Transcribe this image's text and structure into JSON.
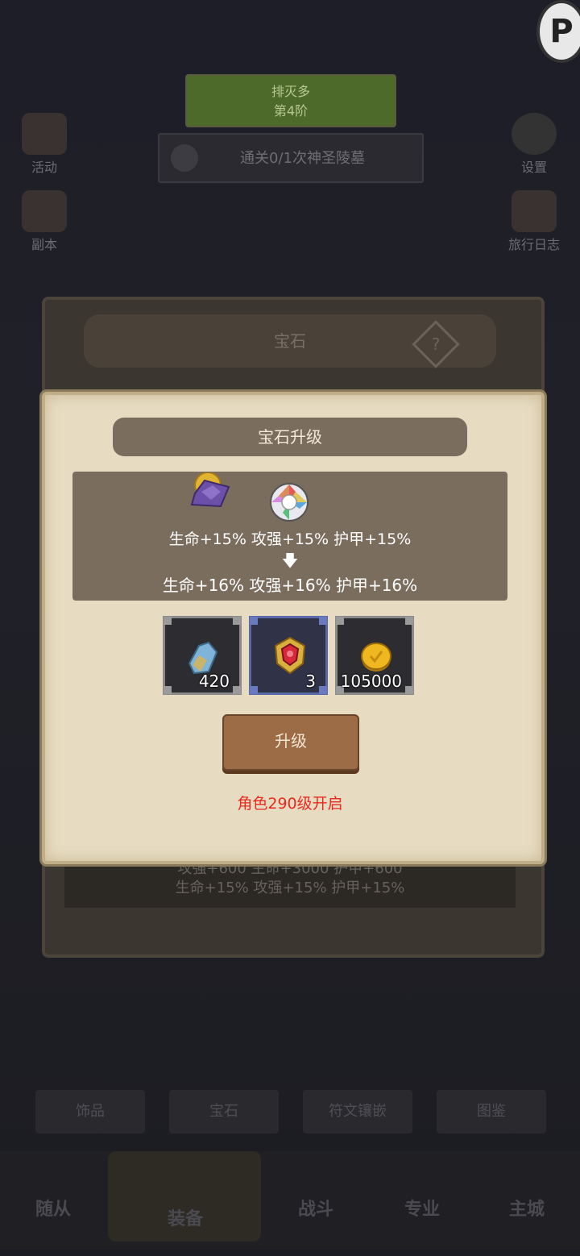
{
  "background": {
    "quest_title": "排灭多",
    "quest_sub": "第4阶",
    "quest_text": "通关0/1次神圣陵墓",
    "left_buttons": [
      "活动",
      "副本"
    ],
    "right_buttons": [
      "设置",
      "旅行日志"
    ],
    "panel_title": "宝石",
    "help_label": "?",
    "stats_line1": "攻强+600   生命+3000   护甲+600",
    "stats_line2": "生命+15%   攻强+15%   护甲+15%",
    "bottom_tabs": [
      "饰品",
      "宝石",
      "符文镶嵌",
      "图鉴"
    ],
    "nav": [
      "随从",
      "装备",
      "战斗",
      "专业",
      "主城"
    ]
  },
  "dialog": {
    "title": "宝石升级",
    "current_bonus": "生命+15%  攻强+15%  护甲+15%",
    "next_bonus": "生命+16%  攻强+16%  护甲+16%",
    "arrow": "🡇",
    "materials": [
      {
        "icon": "crystal-icon",
        "count": "420"
      },
      {
        "icon": "ruby-emblem-icon",
        "count": "3"
      },
      {
        "icon": "gold-coin-icon",
        "count": "105000"
      }
    ],
    "upgrade_label": "升级",
    "unlock_hint": "角色290级开启"
  },
  "colors": {
    "accent_red": "#e8291e",
    "dialog_bg": "#e7dcc2",
    "info_box": "#7a6d5e",
    "button": "#9c6c47"
  }
}
